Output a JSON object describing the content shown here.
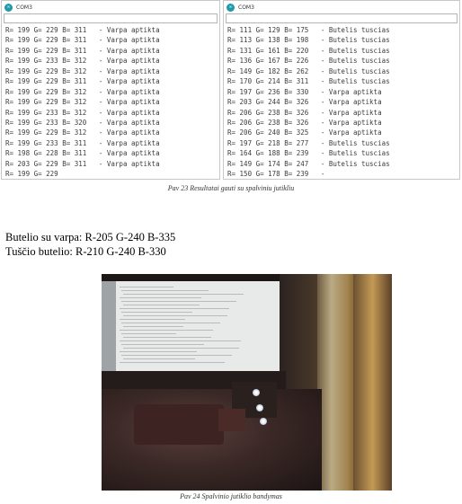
{
  "left_monitor": {
    "title": "COM3",
    "lines": [
      "R= 199 G= 229 B= 311   - Varpa aptikta",
      "R= 199 G= 229 B= 311   - Varpa aptikta",
      "R= 199 G= 229 B= 311   - Varpa aptikta",
      "R= 199 G= 233 B= 312   - Varpa aptikta",
      "R= 199 G= 229 B= 312   - Varpa aptikta",
      "R= 199 G= 229 B= 311   - Varpa aptikta",
      "R= 199 G= 229 B= 312   - Varpa aptikta",
      "R= 199 G= 229 B= 312   - Varpa aptikta",
      "R= 199 G= 233 B= 312   - Varpa aptikta",
      "R= 199 G= 233 B= 320   - Varpa aptikta",
      "R= 199 G= 229 B= 312   - Varpa aptikta",
      "R= 199 G= 233 B= 311   - Varpa aptikta",
      "R= 198 G= 228 B= 311   - Varpa aptikta",
      "R= 203 G= 229 B= 311   - Varpa aptikta",
      "R= 199 G= 229"
    ]
  },
  "right_monitor": {
    "title": "COM3",
    "lines": [
      "R= 111 G= 129 B= 175   - Butelis tuscias",
      "R= 113 G= 138 B= 198   - Butelis tuscias",
      "R= 131 G= 161 B= 220   - Butelis tuscias",
      "R= 136 G= 167 B= 226   - Butelis tuscias",
      "R= 149 G= 182 B= 262   - Butelis tuscias",
      "R= 170 G= 214 B= 311   - Butelis tuscias",
      "R= 197 G= 236 B= 330   - Varpa aptikta",
      "R= 203 G= 244 B= 326   - Varpa aptikta",
      "R= 206 G= 238 B= 326   - Varpa aptikta",
      "R= 206 G= 238 B= 326   - Varpa aptikta",
      "R= 206 G= 240 B= 325   - Varpa aptikta",
      "R= 197 G= 218 B= 277   - Butelis tuscias",
      "R= 164 G= 188 B= 239   - Butelis tuscias",
      "R= 149 G= 174 B= 247   - Butelis tuscias",
      "R= 150 G= 178 B= 239   -"
    ]
  },
  "caption_23": "Pav 23 Resultatai gauti su spalviniu jutikliu",
  "text_varpa": "Butelio su varpa: R-205 G-240 B-335",
  "text_tuscio": "Tuščio butelio: R-210 G-240 B-330",
  "caption_24": "Pav 24 Spalvinio jutiklio bandymas",
  "photo": {
    "icon": "photo-sensor-test"
  },
  "colors": {
    "app_icon": "#1f9aa8",
    "log_text": "#3c3c3c"
  }
}
